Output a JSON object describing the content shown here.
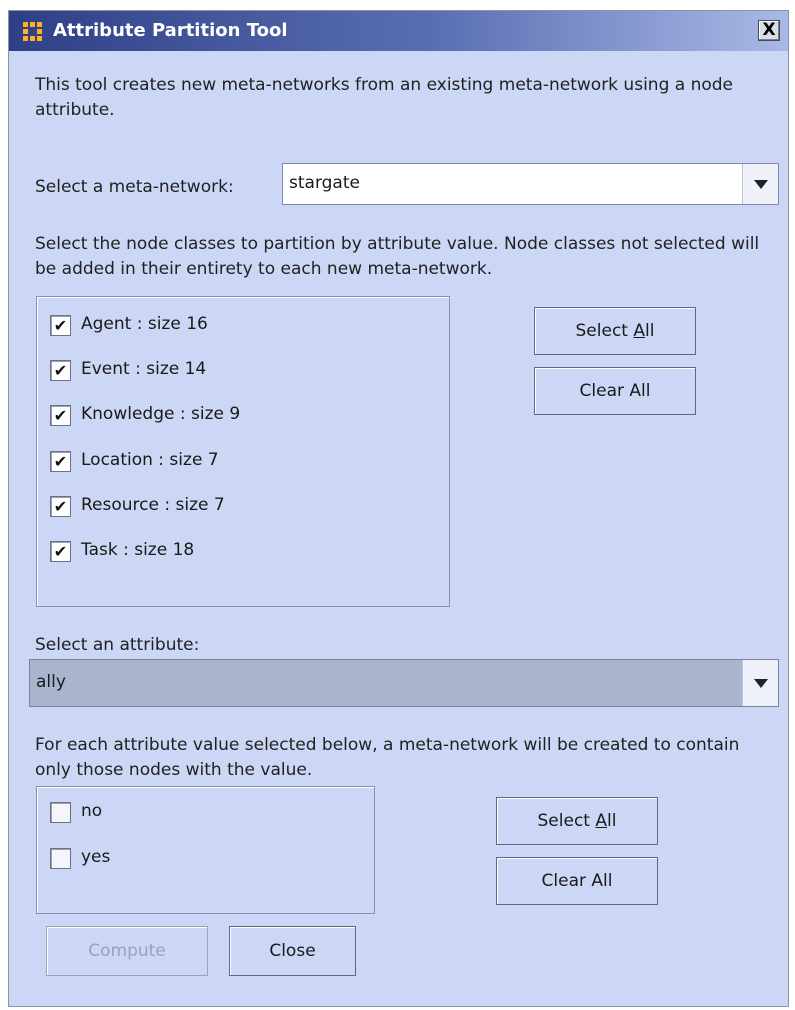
{
  "window": {
    "title": "Attribute Partition Tool",
    "close_glyph": "X",
    "icon": "ora-grid-icon"
  },
  "description": "This tool creates new meta-networks from an existing meta-network using a node attribute.",
  "meta_network": {
    "label": "Select a meta-network:",
    "selected": "stargate"
  },
  "node_classes": {
    "description": "Select the node classes to partition by attribute value. Node classes not selected will be added in their entirety to each new meta-network.",
    "items": [
      {
        "label": "Agent : size 16",
        "checked": true
      },
      {
        "label": "Event : size 14",
        "checked": true
      },
      {
        "label": "Knowledge : size 9",
        "checked": true
      },
      {
        "label": "Location : size 7",
        "checked": true
      },
      {
        "label": "Resource : size 7",
        "checked": true
      },
      {
        "label": "Task : size 18",
        "checked": true
      }
    ],
    "select_all": {
      "pre": "Select ",
      "mnemonic": "A",
      "post": "ll"
    },
    "clear_all": "Clear All"
  },
  "attribute": {
    "label": "Select an attribute:",
    "selected": "ally"
  },
  "attribute_values": {
    "description": "For each attribute value selected below, a meta-network will be created to contain only those nodes with the value.",
    "items": [
      {
        "label": "no",
        "checked": false
      },
      {
        "label": "yes",
        "checked": false
      }
    ],
    "select_all": {
      "pre": "Select ",
      "mnemonic": "A",
      "post": "ll"
    },
    "clear_all": "Clear All"
  },
  "footer": {
    "compute": "Compute",
    "close": "Close"
  },
  "colors": {
    "panel_bg": "#ccd6f5",
    "title_bar": "#2f3f86",
    "icon_accent": "#ffb21a",
    "disabled_text": "#9aa3bb"
  },
  "check_glyph": "✔"
}
